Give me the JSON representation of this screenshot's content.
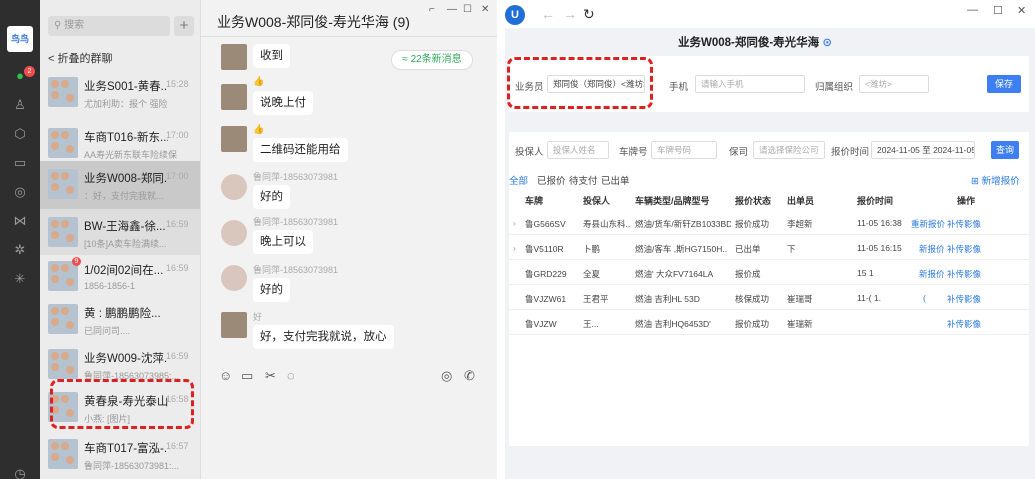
{
  "rail": {
    "logo_text": "鸟鸟",
    "badge": "2"
  },
  "list": {
    "search_placeholder": "搜索",
    "add": "+",
    "back_label": "折叠的群聊",
    "items": [
      {
        "name": "业务S001-黄春...",
        "time": "15:28",
        "preview": "尤加利助：报个 强险",
        "badge": ""
      },
      {
        "name": "车商T016-新东...",
        "time": "17:00",
        "preview": "AA寿光新东联车险续保",
        "badge": ""
      },
      {
        "name": "业务W008-郑同...",
        "time": "17:00",
        "preview": "：好，支付完我就...",
        "badge": ""
      },
      {
        "name": "BW-王海鑫-徐...",
        "time": "16:59",
        "preview": "[10条]A卖车险满续...",
        "badge": ""
      },
      {
        "name": "1/02间02间在...",
        "time": "16:59",
        "preview": "1856-1856-1",
        "badge": "9"
      },
      {
        "name": "黄 : 鹏鹏鹏险...",
        "time": "",
        "preview": "已同问司....",
        "badge": ""
      },
      {
        "name": "业务W009-沈萍...",
        "time": "16:59",
        "preview": "鲁同萍-18563073985:...",
        "badge": ""
      },
      {
        "name": "黄春泉-寿光泰山...",
        "time": "16:58",
        "preview": "小燕: [图片]",
        "badge": ""
      },
      {
        "name": "车商T017-富泓-...",
        "time": "16:57",
        "preview": "鲁同萍-18563073981:...",
        "badge": ""
      }
    ]
  },
  "chat": {
    "title": "业务W008-郑同俊-寿光华海 (9)",
    "new_msgs": "≈ 22条新消息",
    "messages": [
      {
        "name": "",
        "text": "收到"
      },
      {
        "name": "👍",
        "text": "说晚上付"
      },
      {
        "name": "👍",
        "text": "二维码还能用给"
      },
      {
        "name": "鲁同萍-18563073981",
        "text": "好的"
      },
      {
        "name": "鲁同萍-18563073981",
        "text": "晚上可以"
      },
      {
        "name": "鲁同萍-18563073981",
        "text": "好的"
      },
      {
        "name": "好 ",
        "text": "好，支付完我就说，放心"
      }
    ]
  },
  "browser": {
    "page_title": "业务W008-郑同俊-寿光华海",
    "salesman_label": "业务员",
    "salesman_value": "郑同俊（郑同俊）<潍坊>",
    "phone_label": "手机",
    "phone_placeholder": "请输入手机",
    "org_label": "归属组织",
    "org_value": "<潍坊>",
    "save_btn": "保存",
    "insured_label": "投保人",
    "insured_placeholder": "投保人姓名",
    "plate_label": "车牌号",
    "plate_placeholder": "车牌号码",
    "insurer_label": "保司",
    "insurer_placeholder": "请选择保险公司",
    "quote_time_label": "报价时间",
    "date_range": "2024-11-05 至 2024-11-05",
    "query_btn": "查询",
    "tabs": [
      "全部",
      "已报价",
      "待支付",
      "已出单"
    ],
    "add_quote": "新增报价",
    "columns": [
      "车牌",
      "投保人",
      "车辆类型/品牌型号",
      "报价状态",
      "出单员",
      "报价时间",
      "操作"
    ],
    "rows": [
      {
        "plate": "鲁G566SV",
        "insured": "寿县山东科...",
        "model": "燃油/货车/新轩ZB1033BD...",
        "status": "报价成功",
        "issuer": "李超新",
        "time": "11-05 16:38",
        "op1": "重新报价",
        "op2": "补传影像"
      },
      {
        "plate": "鲁V5110R",
        "insured": "卜鹏",
        "model": "燃油/客车 ,斯HG7150H..",
        "status": "已出单",
        "issuer": "下",
        "time": "11-05 16:15",
        "op1": "新报价",
        "op2": "补传影像"
      },
      {
        "plate": "鲁GRD229",
        "insured": "全夏",
        "model": "燃油' 大众FV7164LA",
        "status": "报价成",
        "issuer": "",
        "time": "15 1",
        "op1": "新报价",
        "op2": "补传影像"
      },
      {
        "plate": "鲁VJZW61",
        "insured": "王君平",
        "model": "燃油 吉利HL 53D",
        "status": "核保成功",
        "issuer": "崔瑞哥",
        "time": "11-( 1.",
        "op1": "(",
        "op2": "补传影像"
      },
      {
        "plate": "鲁VJZW",
        "insured": "王...",
        "model": "燃油 吉利HQ6453D'",
        "status": "报价成功",
        "issuer": "崔瑞新",
        "time": "",
        "op1": "",
        "op2": "补传影像"
      }
    ]
  },
  "colors": {
    "accent": "#3d7ff0",
    "wechat_green": "#2fbf4f",
    "annotation": "#e02020"
  }
}
